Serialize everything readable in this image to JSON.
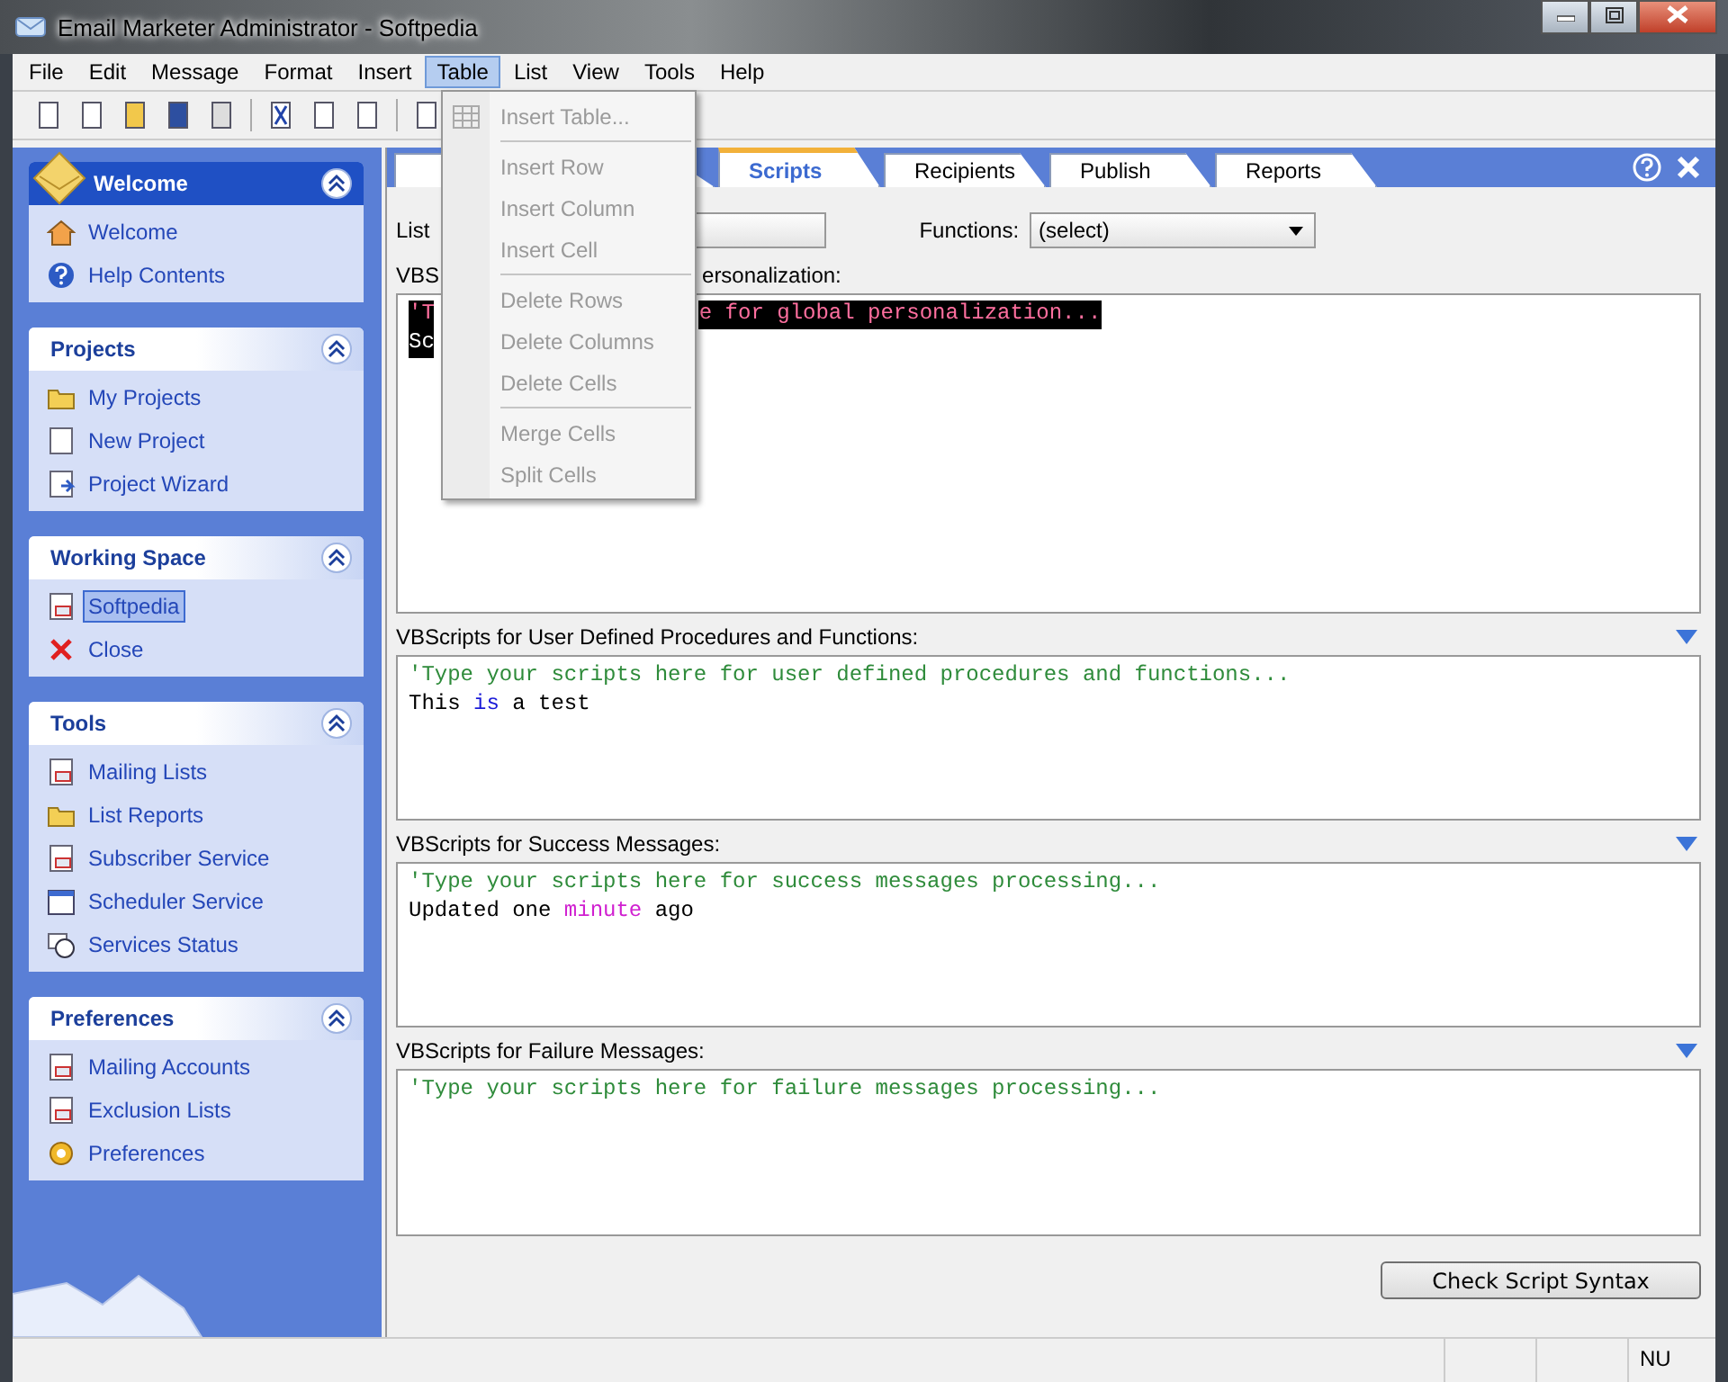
{
  "window": {
    "title": "Email Marketer Administrator - Softpedia"
  },
  "menu_bar": [
    {
      "label": "File",
      "selected": false
    },
    {
      "label": "Edit",
      "selected": false
    },
    {
      "label": "Message",
      "selected": false
    },
    {
      "label": "Format",
      "selected": false
    },
    {
      "label": "Insert",
      "selected": false
    },
    {
      "label": "Table",
      "selected": true
    },
    {
      "label": "List",
      "selected": false
    },
    {
      "label": "View",
      "selected": false
    },
    {
      "label": "Tools",
      "selected": false
    },
    {
      "label": "Help",
      "selected": false
    }
  ],
  "table_menu": [
    {
      "kind": "item",
      "label": "Insert Table...",
      "disabled": true,
      "icon": true
    },
    {
      "kind": "separator"
    },
    {
      "kind": "item",
      "label": "Insert Row",
      "disabled": true
    },
    {
      "kind": "item",
      "label": "Insert Column",
      "disabled": true
    },
    {
      "kind": "item",
      "label": "Insert Cell",
      "disabled": true
    },
    {
      "kind": "separator"
    },
    {
      "kind": "item",
      "label": "Delete Rows",
      "disabled": true
    },
    {
      "kind": "item",
      "label": "Delete Columns",
      "disabled": true
    },
    {
      "kind": "item",
      "label": "Delete Cells",
      "disabled": true
    },
    {
      "kind": "separator"
    },
    {
      "kind": "item",
      "label": "Merge Cells",
      "disabled": true
    },
    {
      "kind": "item",
      "label": "Split Cells",
      "disabled": true
    }
  ],
  "sidebar": [
    {
      "title": "Welcome",
      "kind": "primary",
      "items": [
        {
          "label": "Welcome",
          "selected": false
        },
        {
          "label": "Help Contents",
          "selected": false
        }
      ]
    },
    {
      "title": "Projects",
      "kind": "normal",
      "items": [
        {
          "label": "My Projects",
          "selected": false
        },
        {
          "label": "New Project",
          "selected": false
        },
        {
          "label": "Project Wizard",
          "selected": false
        }
      ]
    },
    {
      "title": "Working Space",
      "kind": "normal",
      "items": [
        {
          "label": "Softpedia",
          "selected": true
        },
        {
          "label": "Close",
          "selected": false
        }
      ]
    },
    {
      "title": "Tools",
      "kind": "normal",
      "items": [
        {
          "label": "Mailing Lists",
          "selected": false
        },
        {
          "label": "List Reports",
          "selected": false
        },
        {
          "label": "Subscriber Service",
          "selected": false
        },
        {
          "label": "Scheduler Service",
          "selected": false
        },
        {
          "label": "Services Status",
          "selected": false
        }
      ]
    },
    {
      "title": "Preferences",
      "kind": "normal",
      "items": [
        {
          "label": "Mailing Accounts",
          "selected": false
        },
        {
          "label": "Exclusion Lists",
          "selected": false
        },
        {
          "label": "Preferences",
          "selected": false
        }
      ]
    }
  ],
  "tabs": [
    {
      "label": "Scripts",
      "selected": true
    },
    {
      "label": "Recipients",
      "selected": false
    },
    {
      "label": "Publish",
      "selected": false
    },
    {
      "label": "Reports",
      "selected": false
    }
  ],
  "list_label": "List",
  "functions_label": "Functions:",
  "functions_value": "(select)",
  "sections": [
    {
      "label": [
        "VBS",
        "ersonalization:"
      ],
      "expand_icon": false,
      "lines": [
        {
          "selected": true,
          "fragments": [
            [
              {
                "kind": "comment",
                "text": "'T"
              }
            ],
            [
              {
                "kind": "comment",
                "text": "e for global personalization..."
              }
            ]
          ]
        },
        {
          "selected": true,
          "fragments": [
            [
              {
                "kind": "plain",
                "text": "Sc"
              }
            ]
          ]
        }
      ]
    },
    {
      "label": [
        "VBScripts for User Defined Procedures and Functions:"
      ],
      "expand_icon": true,
      "lines": [
        {
          "selected": false,
          "fragments": [
            [
              {
                "kind": "comment",
                "text": "'Type your scripts here for user defined procedures and functions..."
              }
            ]
          ]
        },
        {
          "selected": false,
          "fragments": [
            [
              {
                "kind": "plain",
                "text": "This "
              },
              {
                "kind": "keyword",
                "text": "is"
              },
              {
                "kind": "plain",
                "text": " a test"
              }
            ]
          ]
        }
      ]
    },
    {
      "label": [
        "VBScripts for Success Messages:"
      ],
      "expand_icon": true,
      "lines": [
        {
          "selected": false,
          "fragments": [
            [
              {
                "kind": "comment",
                "text": "'Type your scripts here for success messages processing..."
              }
            ]
          ]
        },
        {
          "selected": false,
          "fragments": [
            [
              {
                "kind": "plain",
                "text": "Updated one "
              },
              {
                "kind": "function",
                "text": "minute"
              },
              {
                "kind": "plain",
                "text": " ago"
              }
            ]
          ]
        }
      ]
    },
    {
      "label": [
        "VBScripts for Failure Messages:"
      ],
      "expand_icon": true,
      "lines": [
        {
          "selected": false,
          "fragments": [
            [
              {
                "kind": "comment",
                "text": "'Type your scripts here for failure messages processing..."
              }
            ]
          ]
        }
      ]
    }
  ],
  "check_button": "Check Script Syntax",
  "status_bar": {
    "num": "NU"
  }
}
